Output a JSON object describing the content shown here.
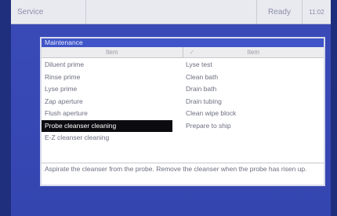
{
  "topbar": {
    "title": "Service",
    "status": "Ready",
    "clock": "11:02"
  },
  "dialog": {
    "title": "Maintenance",
    "column_headers": [
      "Item",
      "Item"
    ],
    "column_header_mark": "✓",
    "left_items": [
      "Diluent prime",
      "Rinse prime",
      "Lyse prime",
      "Zap aperture",
      "Flush aperture",
      "Probe cleanser cleaning",
      "E-Z cleanser cleaning"
    ],
    "right_items": [
      "Lyse test",
      "Clean bath",
      "Drain bath",
      "Drain tubing",
      "Clean wipe block",
      "Prepare to ship"
    ],
    "selected_item": "Probe cleanser cleaning",
    "description": "Aspirate the cleanser from the probe. Remove the cleanser when the probe has risen up."
  }
}
